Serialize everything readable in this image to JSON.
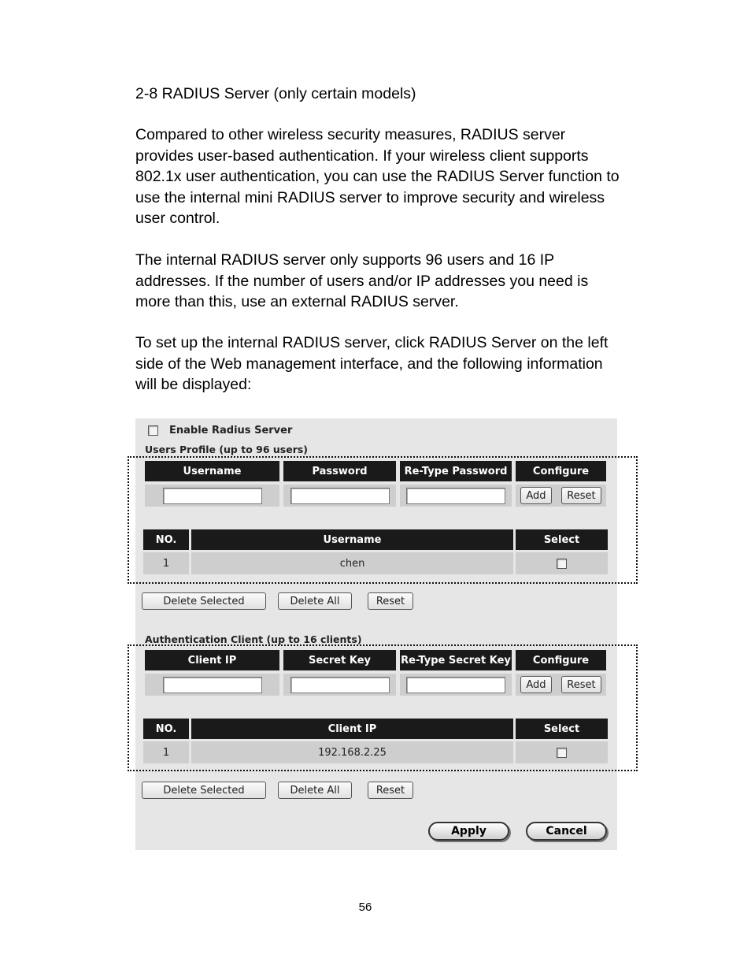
{
  "document": {
    "heading": "2-8 RADIUS Server (only certain models)",
    "paragraphs": [
      "Compared to other wireless security measures, RADIUS server provides user-based authentication. If your wireless client supports 802.1x user authentication, you can use the RADIUS Server function to use the internal mini RADIUS server to improve security and wireless user control.",
      "The internal RADIUS server only supports 96 users and 16 IP addresses. If the number of users and/or IP addresses you need is more than this, use an external RADIUS server.",
      "To set up the internal RADIUS server, click RADIUS Server on the left side of the Web management interface, and the following information will be displayed:"
    ],
    "page_number": "56"
  },
  "panel": {
    "enable_label": "Enable Radius Server",
    "enable_checked": false,
    "users": {
      "title": "Users Profile (up to 96 users)",
      "form_headers": [
        "Username",
        "Password",
        "Re-Type Password",
        "Configure"
      ],
      "add_label": "Add",
      "reset_label": "Reset",
      "list_headers": [
        "NO.",
        "Username",
        "Select"
      ],
      "rows": [
        {
          "no": "1",
          "value": "chen",
          "selected": false
        }
      ],
      "delete_selected_label": "Delete Selected",
      "delete_all_label": "Delete All",
      "list_reset_label": "Reset"
    },
    "clients": {
      "title": "Authentication Client (up to 16 clients)",
      "form_headers": [
        "Client IP",
        "Secret Key",
        "Re-Type Secret Key",
        "Configure"
      ],
      "add_label": "Add",
      "reset_label": "Reset",
      "list_headers": [
        "NO.",
        "Client IP",
        "Select"
      ],
      "rows": [
        {
          "no": "1",
          "value": "192.168.2.25",
          "selected": false
        }
      ],
      "delete_selected_label": "Delete Selected",
      "delete_all_label": "Delete All",
      "list_reset_label": "Reset"
    },
    "apply_label": "Apply",
    "cancel_label": "Cancel"
  }
}
